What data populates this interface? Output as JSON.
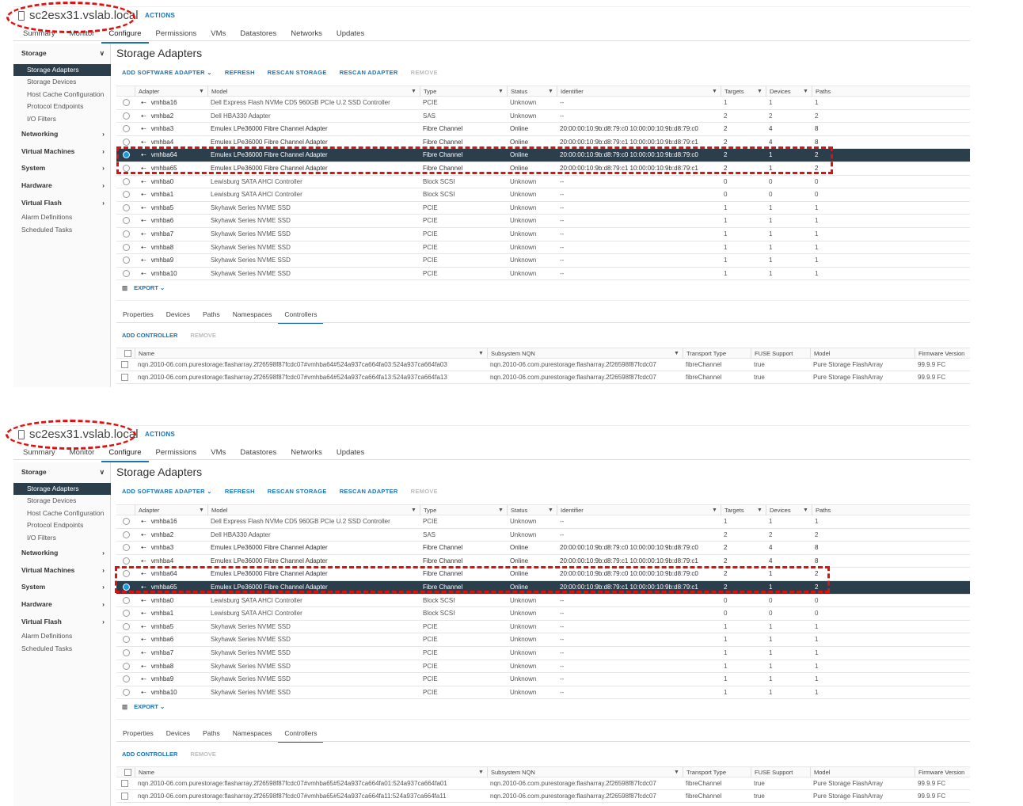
{
  "header": {
    "actions_label": "ACTIONS",
    "tabs": [
      "Summary",
      "Monitor",
      "Configure",
      "Permissions",
      "VMs",
      "Datastores",
      "Networks",
      "Updates"
    ],
    "active_tab": "Configure"
  },
  "sidebar": {
    "items": [
      {
        "label": "Storage",
        "type": "group",
        "chevron": "∨"
      },
      {
        "label": "Storage Adapters",
        "type": "sub",
        "selected": true
      },
      {
        "label": "Storage Devices",
        "type": "sub"
      },
      {
        "label": "Host Cache Configuration",
        "type": "sub"
      },
      {
        "label": "Protocol Endpoints",
        "type": "sub"
      },
      {
        "label": "I/O Filters",
        "type": "sub"
      },
      {
        "label": "Networking",
        "type": "group",
        "chevron": "›"
      },
      {
        "label": "Virtual Machines",
        "type": "group",
        "chevron": "›"
      },
      {
        "label": "System",
        "type": "group",
        "chevron": "›"
      },
      {
        "label": "Hardware",
        "type": "group",
        "chevron": "›"
      },
      {
        "label": "Virtual Flash",
        "type": "group",
        "chevron": "›"
      },
      {
        "label": "Alarm Definitions",
        "type": "leaf"
      },
      {
        "label": "Scheduled Tasks",
        "type": "leaf"
      }
    ]
  },
  "main": {
    "title": "Storage Adapters",
    "toolbar": {
      "add_software_adapter": "ADD SOFTWARE ADAPTER ⌄",
      "refresh": "REFRESH",
      "rescan_storage": "RESCAN STORAGE",
      "rescan_adapter": "RESCAN ADAPTER",
      "remove": "REMOVE"
    },
    "export_label": "EXPORT ⌄"
  },
  "adapters_columns": [
    "Adapter",
    "Model",
    "Type",
    "Status",
    "Identifier",
    "Targets",
    "Devices",
    "Paths"
  ],
  "adapters": [
    [
      "vmhba16",
      "Dell Express Flash NVMe CD5 960GB PCIe U.2 SSD Controller",
      "PCIE",
      "Unknown",
      "--",
      "1",
      "1",
      "1"
    ],
    [
      "vmhba2",
      "Dell HBA330 Adapter",
      "SAS",
      "Unknown",
      "--",
      "2",
      "2",
      "2"
    ],
    [
      "vmhba3",
      "Emulex LPe36000 Fibre Channel Adapter",
      "Fibre Channel",
      "Online",
      "20:00:00:10:9b:d8:79:c0 10:00:00:10:9b:d8:79:c0",
      "2",
      "4",
      "8"
    ],
    [
      "vmhba4",
      "Emulex LPe36000 Fibre Channel Adapter",
      "Fibre Channel",
      "Online",
      "20:00:00:10:9b:d8:79:c1 10:00:00:10:9b:d8:79:c1",
      "2",
      "4",
      "8"
    ],
    [
      "vmhba64",
      "Emulex LPe36000 Fibre Channel Adapter",
      "Fibre Channel",
      "Online",
      "20:00:00:10:9b:d8:79:c0 10:00:00:10:9b:d8:79:c0",
      "2",
      "1",
      "2"
    ],
    [
      "vmhba65",
      "Emulex LPe36000 Fibre Channel Adapter",
      "Fibre Channel",
      "Online",
      "20:00:00:10:9b:d8:79:c1 10:00:00:10:9b:d8:79:c1",
      "2",
      "1",
      "2"
    ],
    [
      "vmhba0",
      "Lewisburg SATA AHCI Controller",
      "Block SCSI",
      "Unknown",
      "--",
      "0",
      "0",
      "0"
    ],
    [
      "vmhba1",
      "Lewisburg SATA AHCI Controller",
      "Block SCSI",
      "Unknown",
      "--",
      "0",
      "0",
      "0"
    ],
    [
      "vmhba5",
      "Skyhawk Series NVME SSD",
      "PCIE",
      "Unknown",
      "--",
      "1",
      "1",
      "1"
    ],
    [
      "vmhba6",
      "Skyhawk Series NVME SSD",
      "PCIE",
      "Unknown",
      "--",
      "1",
      "1",
      "1"
    ],
    [
      "vmhba7",
      "Skyhawk Series NVME SSD",
      "PCIE",
      "Unknown",
      "--",
      "1",
      "1",
      "1"
    ],
    [
      "vmhba8",
      "Skyhawk Series NVME SSD",
      "PCIE",
      "Unknown",
      "--",
      "1",
      "1",
      "1"
    ],
    [
      "vmhba9",
      "Skyhawk Series NVME SSD",
      "PCIE",
      "Unknown",
      "--",
      "1",
      "1",
      "1"
    ],
    [
      "vmhba10",
      "Skyhawk Series NVME SSD",
      "PCIE",
      "Unknown",
      "--",
      "1",
      "1",
      "1"
    ]
  ],
  "detail": {
    "tabs": [
      "Properties",
      "Devices",
      "Paths",
      "Namespaces",
      "Controllers"
    ],
    "active_tab": "Controllers",
    "add_controller": "ADD CONTROLLER",
    "remove": "REMOVE",
    "columns": [
      "Name",
      "Subsystem NQN",
      "Transport Type",
      "FUSE Support",
      "Model",
      "Firmware Version"
    ]
  },
  "panels": [
    {
      "host": "sc2esx31.vslab.local",
      "selected_index": 4,
      "controllers": [
        [
          "nqn.2010-06.com.purestorage:flasharray.2f26598f87fcdc07#vmhba64#524a937ca664fa03:524a937ca664fa03",
          "nqn.2010-06.com.purestorage:flasharray.2f26598f87fcdc07",
          "fibreChannel",
          "true",
          "Pure Storage FlashArray",
          "99.9.9 FC"
        ],
        [
          "nqn.2010-06.com.purestorage:flasharray.2f26598f87fcdc07#vmhba64#524a937ca664fa13:524a937ca664fa13",
          "nqn.2010-06.com.purestorage:flasharray.2f26598f87fcdc07",
          "fibreChannel",
          "true",
          "Pure Storage FlashArray",
          "99.9.9 FC"
        ]
      ]
    },
    {
      "host": "sc2esx31.vslab.local",
      "selected_index": 5,
      "controllers": [
        [
          "nqn.2010-06.com.purestorage:flasharray.2f26598f87fcdc07#vmhba65#524a937ca664fa01:524a937ca664fa01",
          "nqn.2010-06.com.purestorage:flasharray.2f26598f87fcdc07",
          "fibreChannel",
          "true",
          "Pure Storage FlashArray",
          "99.9.9 FC"
        ],
        [
          "nqn.2010-06.com.purestorage:flasharray.2f26598f87fcdc07#vmhba65#524a937ca664fa11:524a937ca664fa11",
          "nqn.2010-06.com.purestorage:flasharray.2f26598f87fcdc07",
          "fibreChannel",
          "true",
          "Pure Storage FlashArray",
          "99.9.9 FC"
        ]
      ]
    }
  ],
  "colors": {
    "accent": "#1a73b8",
    "selected_row": "#2b3e4c",
    "annotation": "#e01010"
  }
}
